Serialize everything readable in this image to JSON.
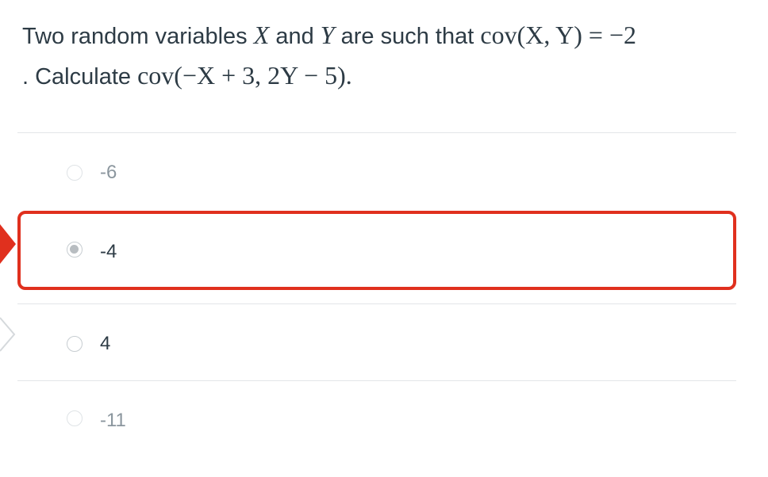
{
  "question": {
    "line1_prefix": "Two random variables ",
    "var_x": "X",
    "and_text": " and ",
    "var_y": "Y",
    "line1_mid": " are such that ",
    "cov_given": "cov(X, Y) = −2",
    "line2_prefix": ". Calculate ",
    "cov_query": "cov(−X + 3, 2Y − 5)."
  },
  "answers": [
    {
      "label": "-6",
      "selected": false
    },
    {
      "label": "-4",
      "selected": true,
      "marked_correct": true
    },
    {
      "label": "4",
      "selected": false
    },
    {
      "label": "-11",
      "selected": false
    }
  ],
  "colors": {
    "correct_border": "#e0301e",
    "text": "#2d3b45",
    "faint_text": "#8b969e",
    "divider": "#e3e5e8"
  },
  "icons": [
    "correct-answer-arrow-icon",
    "answer-arrow-outline-icon"
  ]
}
